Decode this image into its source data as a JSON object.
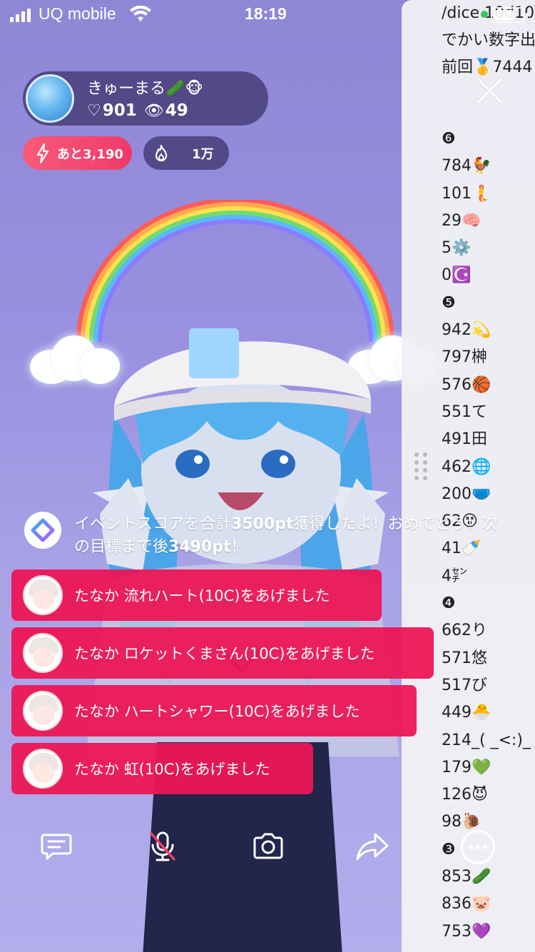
{
  "status_bar": {
    "carrier": "UQ mobile",
    "time": "18:19"
  },
  "host": {
    "name": "きゅーまる🥒🐵",
    "likes_icon": "♡",
    "likes": "901",
    "viewers_icon": "👁",
    "viewers": "49"
  },
  "badges": {
    "boost_label": "あと3,190",
    "fire_label": "1万"
  },
  "right_panel": {
    "header_lines": [
      "/dice 10d100",
      "でかい数字出",
      "前回🥇7444"
    ],
    "rows": [
      "❻",
      "784🐓",
      "101🧜",
      "29🧠",
      "5⚙️",
      "0☪️",
      "❺",
      "942💫",
      "797榊",
      "576🏀",
      "551て",
      "491田",
      "462🌐",
      "200🩲",
      "62😵",
      "41🍼",
      "4㌢",
      "❹",
      "662り",
      "571悠",
      "517び",
      "449🐣",
      "214_( _<:)_",
      "179💚",
      "126😈",
      "98🐌",
      "❸",
      "853🥒",
      "836🐷",
      "753💜"
    ]
  },
  "system_message": {
    "text_a": "イベントスコアを合計",
    "score": "3500pt",
    "text_b": "獲得したよ！おめでとう！次の目標まで後",
    "remaining": "3490pt",
    "text_c": "！"
  },
  "gifts": [
    {
      "user": "たなか",
      "text": "流れハート(10C)をあげました"
    },
    {
      "user": "たなか",
      "text": "ロケットくまさん(10C)をあげました"
    },
    {
      "user": "たなか",
      "text": "ハートシャワー(10C)をあげました"
    },
    {
      "user": "たなか",
      "text": "虹(10C)をあげました"
    }
  ],
  "toolbar": {
    "icons": [
      "comment-icon",
      "mic-off-icon",
      "camera-icon",
      "share-icon",
      "more-icon"
    ]
  },
  "colors": {
    "background": "#9990e0",
    "gift_bubble": "#ec1656",
    "boost_badge": "#f03a6a",
    "host_card": "#463e78"
  }
}
